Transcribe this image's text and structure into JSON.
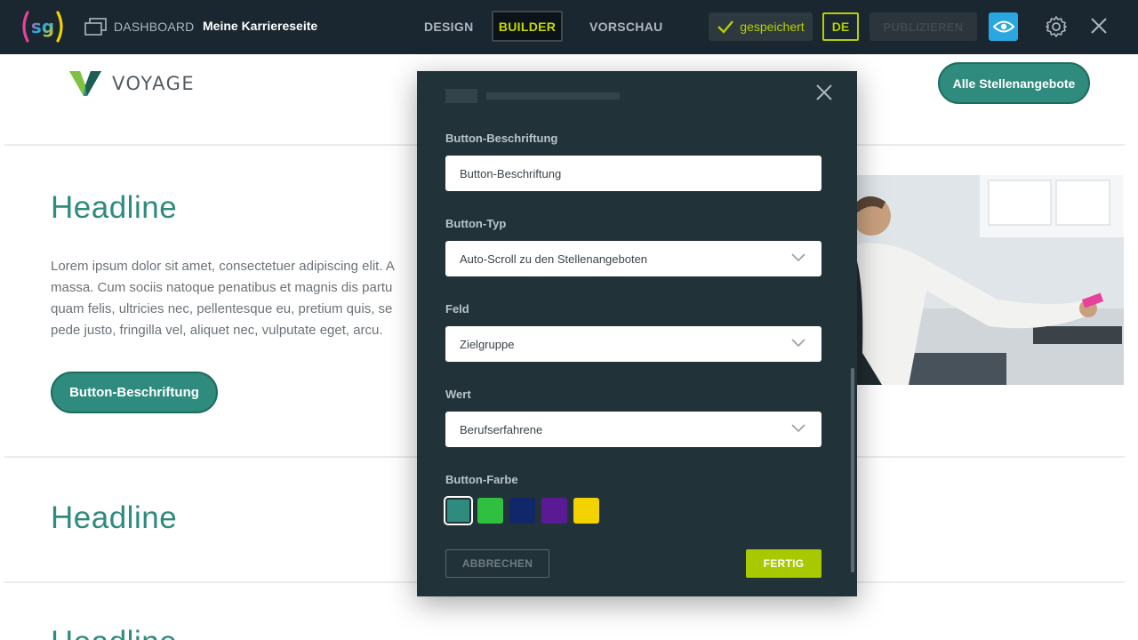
{
  "topbar": {
    "logo_text": "sg",
    "dashboard_label": "DASHBOARD",
    "site_name": "Meine Karriereseite",
    "tabs": [
      {
        "label": "DESIGN"
      },
      {
        "label": "BUILDER"
      },
      {
        "label": "VORSCHAU"
      }
    ],
    "saved_label": "gespeichert",
    "language": "DE",
    "publish_label": "PUBLIZIEREN",
    "colors": {
      "bar": "#1a2630",
      "accent": "#b6cf00",
      "preview": "#2aa7e0"
    }
  },
  "page": {
    "brand_name": "VOYAGE",
    "all_jobs_button": "Alle Stellenangebote",
    "sections": [
      {
        "headline": "Headline",
        "lorem_lines": [
          "Lorem ipsum dolor sit amet, consectetuer adipiscing elit. A",
          "massa. Cum sociis natoque penatibus et magnis dis partu",
          "quam felis, ultricies nec, pellentesque eu, pretium quis, se",
          "pede justo, fringilla vel, aliquet nec, vulputate eget, arcu."
        ],
        "button_label": "Button-Beschriftung"
      },
      {
        "headline": "Headline"
      },
      {
        "headline": "Headline"
      }
    ],
    "accent_color": "#2e8b7d"
  },
  "modal": {
    "fields": {
      "label_caption": "Button-Beschriftung",
      "label_value": "Button-Beschriftung",
      "type_caption": "Button-Typ",
      "type_value": "Auto-Scroll zu den Stellenangeboten",
      "field_caption": "Feld",
      "field_value": "Zielgruppe",
      "value_caption": "Wert",
      "value_value": "Berufserfahrene",
      "color_caption": "Button-Farbe"
    },
    "colors": [
      {
        "name": "teal",
        "hex": "#2e8b7d",
        "selected": true
      },
      {
        "name": "green",
        "hex": "#2ec03e",
        "selected": false
      },
      {
        "name": "navy",
        "hex": "#10286a",
        "selected": false
      },
      {
        "name": "purple",
        "hex": "#5a1a94",
        "selected": false
      },
      {
        "name": "yellow",
        "hex": "#f2d300",
        "selected": false
      }
    ],
    "cancel_label": "ABBRECHEN",
    "done_label": "FERTIG"
  }
}
